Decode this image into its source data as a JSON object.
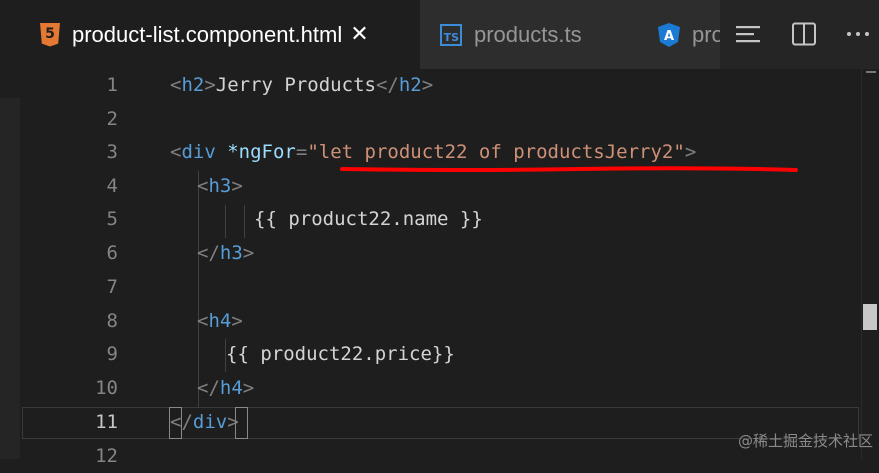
{
  "tabs": [
    {
      "label": "product-list.component.html",
      "icon": "html5-icon",
      "active": true,
      "close": "✕"
    },
    {
      "label": "products.ts",
      "icon": "typescript-icon"
    },
    {
      "label": "pro",
      "icon": "angular-icon"
    }
  ],
  "icons": {
    "html5_glyph": "5",
    "ts_glyph": "TS",
    "angular_glyph": "A"
  },
  "actions": [
    "outline-icon",
    "split-editor-icon",
    "more-actions-icon"
  ],
  "editor": {
    "current_line": "11",
    "lines": [
      {
        "n": "1"
      },
      {
        "n": "2"
      },
      {
        "n": "3"
      },
      {
        "n": "4"
      },
      {
        "n": "5"
      },
      {
        "n": "6"
      },
      {
        "n": "7"
      },
      {
        "n": "8"
      },
      {
        "n": "9"
      },
      {
        "n": "10"
      },
      {
        "n": "11"
      },
      {
        "n": "12"
      }
    ],
    "tokens": {
      "l1_open": "<",
      "l1_tag": "h2",
      "l1_close": ">",
      "l1_text": "Jerry Products",
      "l1_end_open": "</",
      "l1_end_tag": "h2",
      "l1_end_close": ">",
      "l3_open": "<",
      "l3_tag": "div",
      "l3_attr": " *ngFor",
      "l3_eq": "=",
      "l3_str": "\"let product22 of productsJerry2\"",
      "l3_close": ">",
      "l4_open": "<",
      "l4_tag": "h3",
      "l4_close": ">",
      "l5_text": "{{ product22.name }}",
      "l6_open": "</",
      "l6_tag": "h3",
      "l6_close": ">",
      "l8_open": "<",
      "l8_tag": "h4",
      "l8_close": ">",
      "l9_text": "{{ product22.price}}",
      "l10_open": "</",
      "l10_tag": "h4",
      "l10_close": ">",
      "l11_open": "</",
      "l11_tag": "div",
      "l11_close": ">"
    }
  },
  "colors": {
    "tag": "#569cd6",
    "attribute": "#9cdcfe",
    "string": "#ce9178",
    "punctuation": "#808080",
    "annotation": "#ff0000"
  },
  "watermark": "@稀土掘金技术社区"
}
